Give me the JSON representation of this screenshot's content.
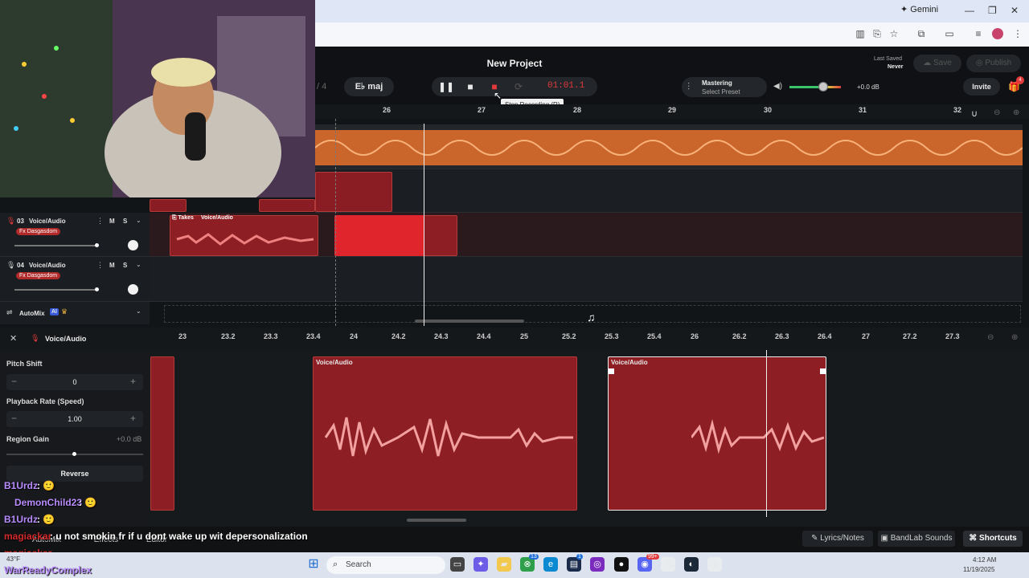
{
  "browser": {
    "gemini_label": "Gemini",
    "window_controls": [
      "—",
      "❐",
      "✕"
    ]
  },
  "header": {
    "project_title": "New Project",
    "key_label": "E♭ maj",
    "key_prev_fragment": "/ 4",
    "timer": "01:01.1",
    "tooltip": "Stop Recording (R)",
    "mastering_title": "Mastering",
    "mastering_preset": "Select Preset",
    "volume_db": "+0.0 dB",
    "last_saved_label": "Last Saved",
    "last_saved_value": "Never",
    "save_label": "Save",
    "publish_label": "Publish",
    "invite_label": "Invite",
    "gift_badge": "4"
  },
  "timeline_ruler": [
    "26",
    "27",
    "28",
    "29",
    "30",
    "31",
    "32"
  ],
  "tracks": [
    {
      "number": "03",
      "name": "Voice/Audio",
      "fx": "Fx Dasgasdom",
      "mute": "M",
      "solo": "S"
    },
    {
      "number": "04",
      "name": "Voice/Audio",
      "fx": "Fx Dasgasdom",
      "mute": "M",
      "solo": "S"
    }
  ],
  "takes_region": {
    "takes_label": "Takes",
    "region_label": "Voice/Audio"
  },
  "automix": {
    "label": "AutoMix",
    "badge": "AI"
  },
  "editor": {
    "title": "Voice/Audio",
    "ruler": [
      "23",
      "23.2",
      "23.3",
      "23.4",
      "24",
      "24.2",
      "24.3",
      "24.4",
      "25",
      "25.2",
      "25.3",
      "25.4",
      "26",
      "26.2",
      "26.3",
      "26.4",
      "27",
      "27.2",
      "27.3"
    ],
    "region1_label": "Voice/Audio",
    "region2_label": "Voice/Audio"
  },
  "left_panel": {
    "pitch_label": "Pitch Shift",
    "pitch_value": "0",
    "rate_label": "Playback Rate (Speed)",
    "rate_value": "1.00",
    "gain_label": "Region Gain",
    "gain_value": "+0.0 dB",
    "reverse_label": "Reverse",
    "minus": "−",
    "plus": "+"
  },
  "bottom_bar": {
    "lyrics": "Lyrics/Notes",
    "sounds": "BandLab Sounds",
    "shortcuts": "Shortcuts",
    "automix_tab": "AutoMix",
    "effects_tab": "Effects",
    "editor_tab": "Editor"
  },
  "chat": [
    {
      "user": "B1Urdz",
      "text": "",
      "color": "#b98cff"
    },
    {
      "user": "DemonChild23",
      "text": "",
      "color": "#b98cff"
    },
    {
      "user": "B1Urdz",
      "text": "",
      "color": "#b98cff"
    },
    {
      "user": "magiackar",
      "text": "u not smokin fr if u dont wake up wit depersonalization",
      "color": "#d42a2a"
    },
    {
      "user": "magiackar",
      "text": "",
      "color": "#d42a2a"
    },
    {
      "user": "WarReadyComplex",
      "text": "",
      "color": "#b98cff"
    }
  ],
  "taskbar": {
    "weather": "43°F",
    "search": "Search",
    "time": "4:12 AM",
    "date": "11/19/2025",
    "badge1": "13",
    "badge2": "1",
    "badge3": "99+"
  }
}
